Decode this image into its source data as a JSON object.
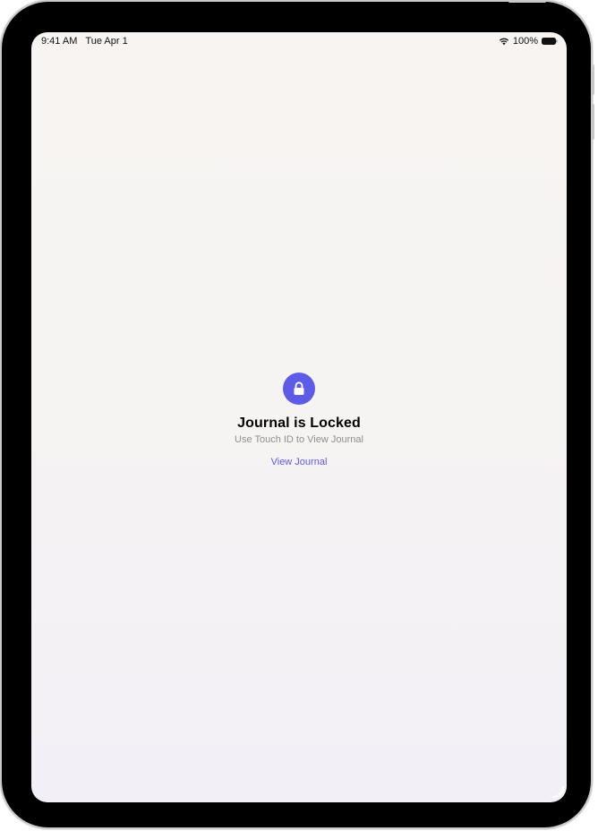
{
  "status_bar": {
    "time": "9:41 AM",
    "date": "Tue Apr 1",
    "battery": "100%",
    "wifi_icon": "wifi-icon",
    "battery_icon": "battery-icon"
  },
  "lock_screen": {
    "icon": "lock-icon",
    "accent_color": "#5E5CE6",
    "title": "Journal is Locked",
    "subtitle": "Use Touch ID to View Journal",
    "action_label": "View Journal"
  }
}
